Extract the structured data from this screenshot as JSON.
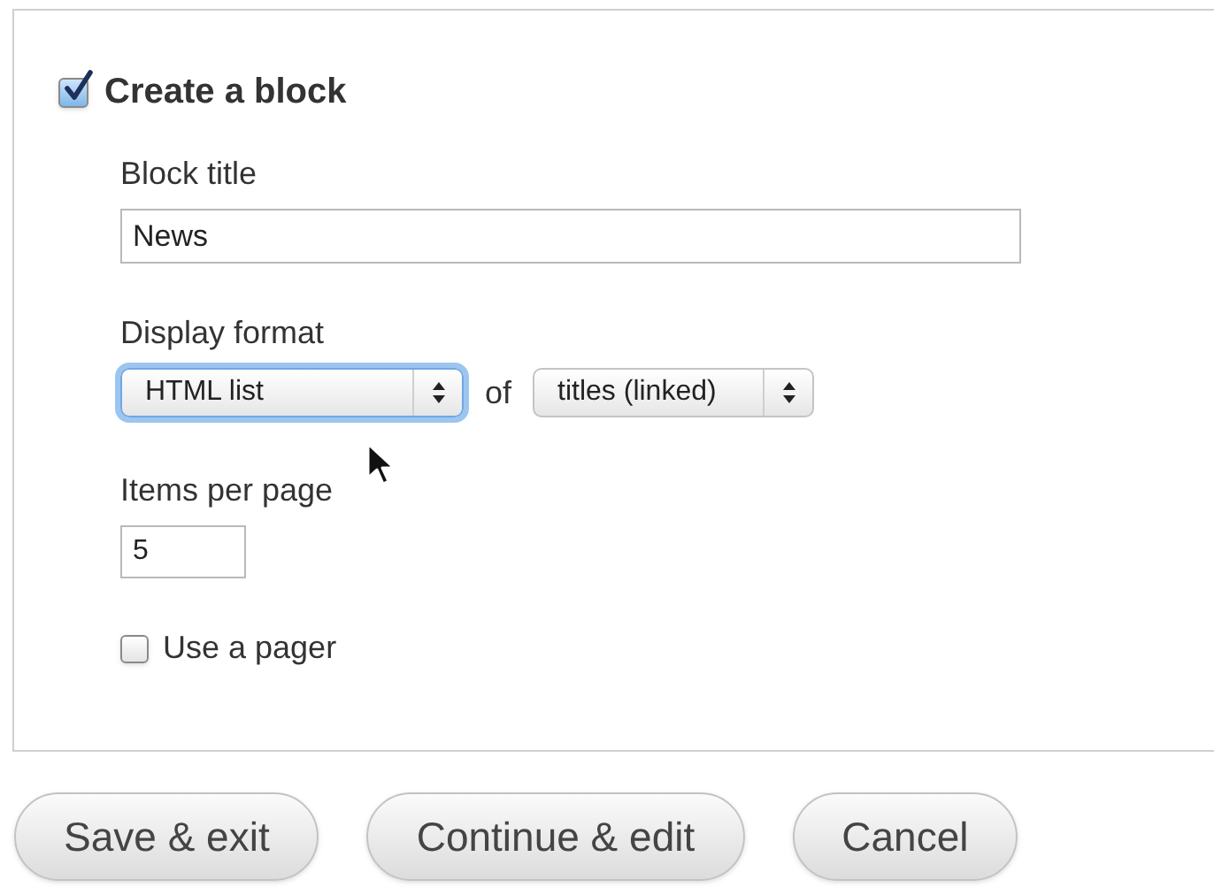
{
  "block": {
    "label": "Create a block",
    "checked": true
  },
  "block_title": {
    "label": "Block title",
    "value": "News"
  },
  "display_format": {
    "label": "Display format",
    "format": {
      "value": "HTML list",
      "focused": true
    },
    "connector": "of",
    "style": {
      "value": "titles (linked)",
      "focused": false
    }
  },
  "items_per_page": {
    "label": "Items per page",
    "value": "5"
  },
  "pager": {
    "label": "Use a pager",
    "checked": false
  },
  "buttons": [
    "Save & exit",
    "Continue & edit",
    "Cancel"
  ]
}
